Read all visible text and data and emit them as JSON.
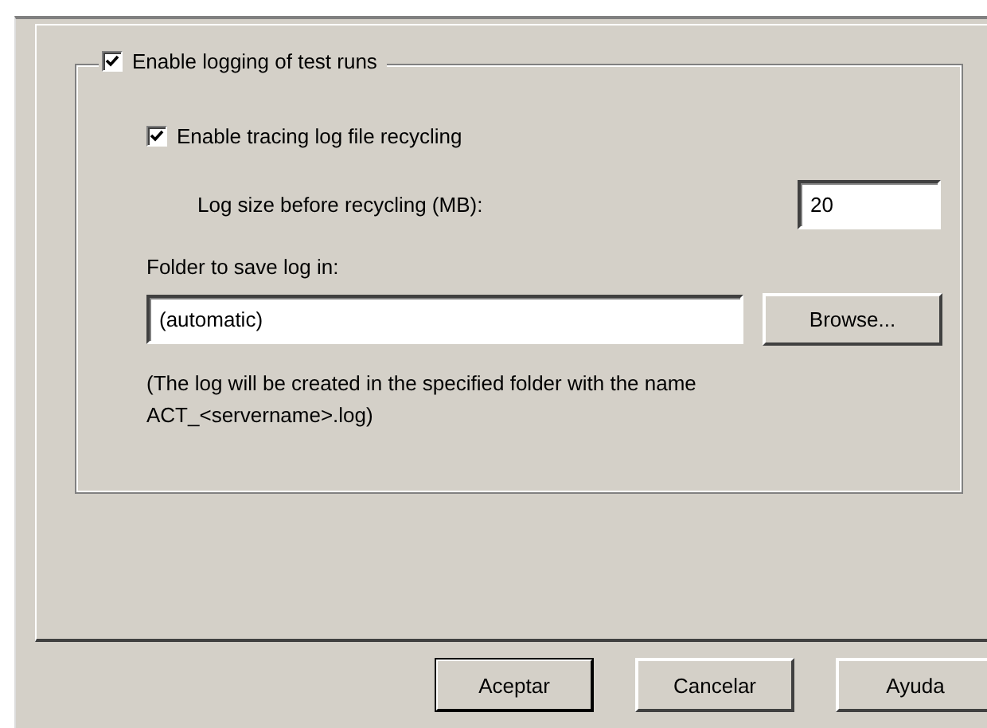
{
  "logging": {
    "label": "Enable logging of test runs",
    "checked": true
  },
  "recycling": {
    "label": "Enable tracing log file recycling",
    "checked": true
  },
  "log_size": {
    "label": "Log size before recycling (MB):",
    "value": "20"
  },
  "folder": {
    "label": "Folder to save log in:",
    "value": "(automatic)",
    "button": "Browse..."
  },
  "note": "(The log will be created in the specified folder with the name ACT_<servername>.log)",
  "buttons": [
    {
      "label": "Aceptar",
      "default": true
    },
    {
      "label": "Cancelar",
      "default": false
    },
    {
      "label": "Ayuda",
      "default": false
    }
  ]
}
